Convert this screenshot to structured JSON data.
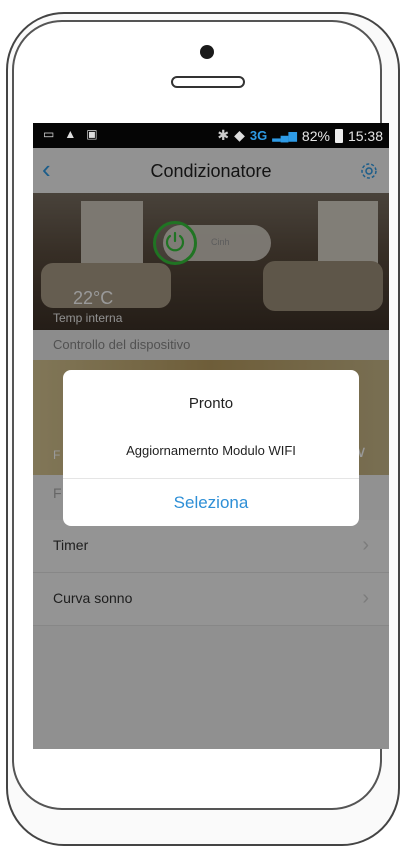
{
  "status_bar": {
    "battery_percent": "82%",
    "time": "15:38",
    "network": "3G"
  },
  "nav": {
    "title": "Condizionatore"
  },
  "hero": {
    "temperature": "22°C",
    "temperature_label": "Temp interna",
    "device_label": "Cinh"
  },
  "sections": {
    "device_control": "Controllo del dispositivo"
  },
  "function_row_letter": "F",
  "list": {
    "timer": "Timer",
    "sleep_curve": "Curva sonno"
  },
  "dialog": {
    "title": "Pronto",
    "message": "Aggiornamernto Modulo WIFI",
    "button": "Seleziona"
  },
  "colors": {
    "accent": "#2e9be6",
    "power_green": "#36c23b"
  }
}
